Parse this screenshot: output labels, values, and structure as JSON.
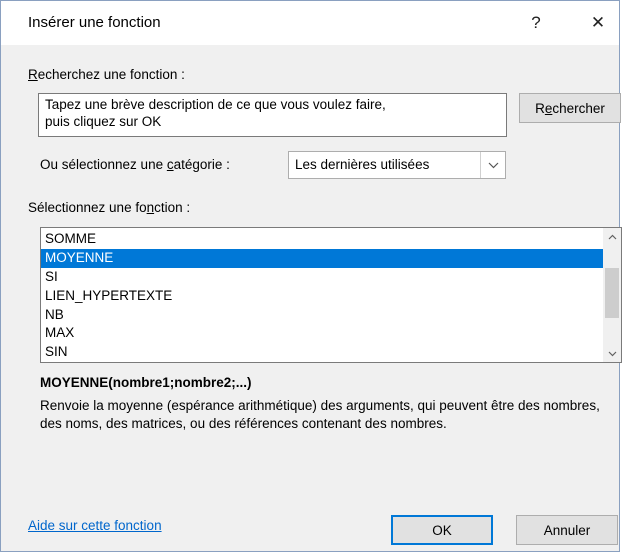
{
  "window": {
    "title": "Insérer une fonction",
    "help_glyph": "?",
    "close_glyph": "✕"
  },
  "search": {
    "label_u": "R",
    "label_rest": "echerchez une fonction :",
    "value_line1": "Tapez une brève description de ce que vous voulez faire,",
    "value_line2": "puis cliquez sur OK",
    "button_before": "R",
    "button_u": "e",
    "button_after": "chercher"
  },
  "category": {
    "label_before": "Ou sélectionnez une ",
    "label_u": "c",
    "label_after": "atégorie :",
    "selected": "Les dernières utilisées"
  },
  "functions": {
    "label_before": "Sélectionnez une fo",
    "label_u": "n",
    "label_after": "ction :",
    "items": [
      "SOMME",
      "MOYENNE",
      "SI",
      "LIEN_HYPERTEXTE",
      "NB",
      "MAX",
      "SIN"
    ],
    "selected_index": 1
  },
  "details": {
    "signature": "MOYENNE(nombre1;nombre2;...)",
    "description": "Renvoie la moyenne (espérance arithmétique) des arguments, qui peuvent être des nombres, des noms, des matrices, ou des références contenant des nombres."
  },
  "footer": {
    "help_link": "Aide sur cette fonction",
    "ok": "OK",
    "cancel": "Annuler"
  },
  "colors": {
    "selection": "#0078d7",
    "link": "#0066cc",
    "dialog_bg": "#f0f0f0"
  }
}
